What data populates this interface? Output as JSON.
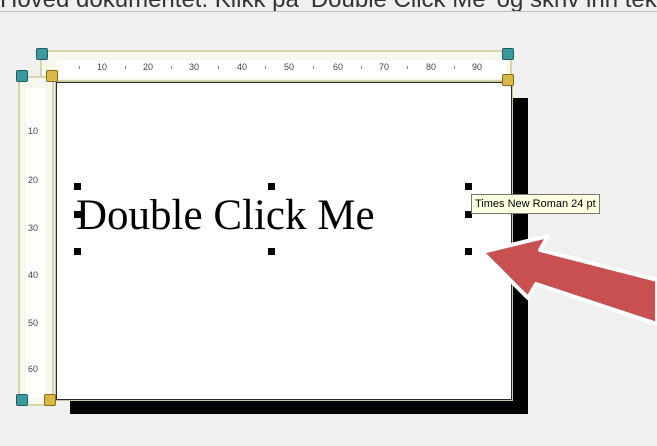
{
  "caption": {
    "text": "Hoved dokumentet. Klikk på ‘Double Click Me’ og skriv inn tekst eller velg"
  },
  "ruler": {
    "horizontal_ticks": [
      "10",
      "20",
      "30",
      "40",
      "50",
      "60",
      "70",
      "80",
      "90"
    ],
    "vertical_ticks": [
      "10",
      "20",
      "30",
      "40",
      "50",
      "60"
    ]
  },
  "textbox": {
    "text": "Double Click Me"
  },
  "tooltip": {
    "text": "Times New Roman 24 pt"
  },
  "colors": {
    "background": "#f0f0f0",
    "ruler_frame": "#d6d4a8",
    "arrow_fill": "#c85050",
    "tooltip_bg": "#ffffe1"
  }
}
